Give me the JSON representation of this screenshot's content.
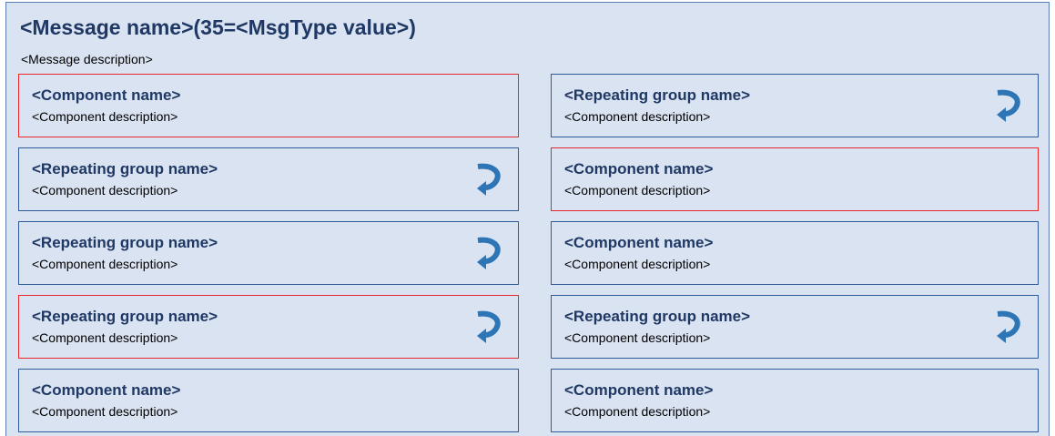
{
  "message": {
    "title": "<Message name>(35=<MsgType value>)",
    "description": "<Message description>"
  },
  "colors": {
    "panel_background": "#dae3f2",
    "title_text": "#1f3864",
    "box_border": "#2e5c9a",
    "required_border": "#e8262a",
    "repeat_icon": "#2e75b6"
  },
  "left_column": [
    {
      "name": "<Component name>",
      "description": "<Component description>",
      "kind": "component",
      "required": true,
      "icon": null
    },
    {
      "name": "<Repeating group name>",
      "description": "<Component description>",
      "kind": "repeating-group",
      "required": false,
      "icon": "repeat-arrow-icon"
    },
    {
      "name": "<Repeating group name>",
      "description": "<Component description>",
      "kind": "repeating-group",
      "required": false,
      "icon": "repeat-arrow-icon"
    },
    {
      "name": "<Repeating group name>",
      "description": "<Component description>",
      "kind": "repeating-group",
      "required": true,
      "icon": "repeat-arrow-icon"
    },
    {
      "name": "<Component name>",
      "description": "<Component description>",
      "kind": "component",
      "required": false,
      "icon": null
    }
  ],
  "right_column": [
    {
      "name": "<Repeating group name>",
      "description": "<Component description>",
      "kind": "repeating-group",
      "required": false,
      "icon": "repeat-arrow-icon"
    },
    {
      "name": "<Component name>",
      "description": "<Component description>",
      "kind": "component",
      "required": true,
      "icon": null
    },
    {
      "name": "<Component name>",
      "description": "<Component description>",
      "kind": "component",
      "required": false,
      "icon": null
    },
    {
      "name": "<Repeating group name>",
      "description": "<Component description>",
      "kind": "repeating-group",
      "required": false,
      "icon": "repeat-arrow-icon"
    },
    {
      "name": "<Component name>",
      "description": "<Component description>",
      "kind": "component",
      "required": false,
      "icon": null
    }
  ]
}
